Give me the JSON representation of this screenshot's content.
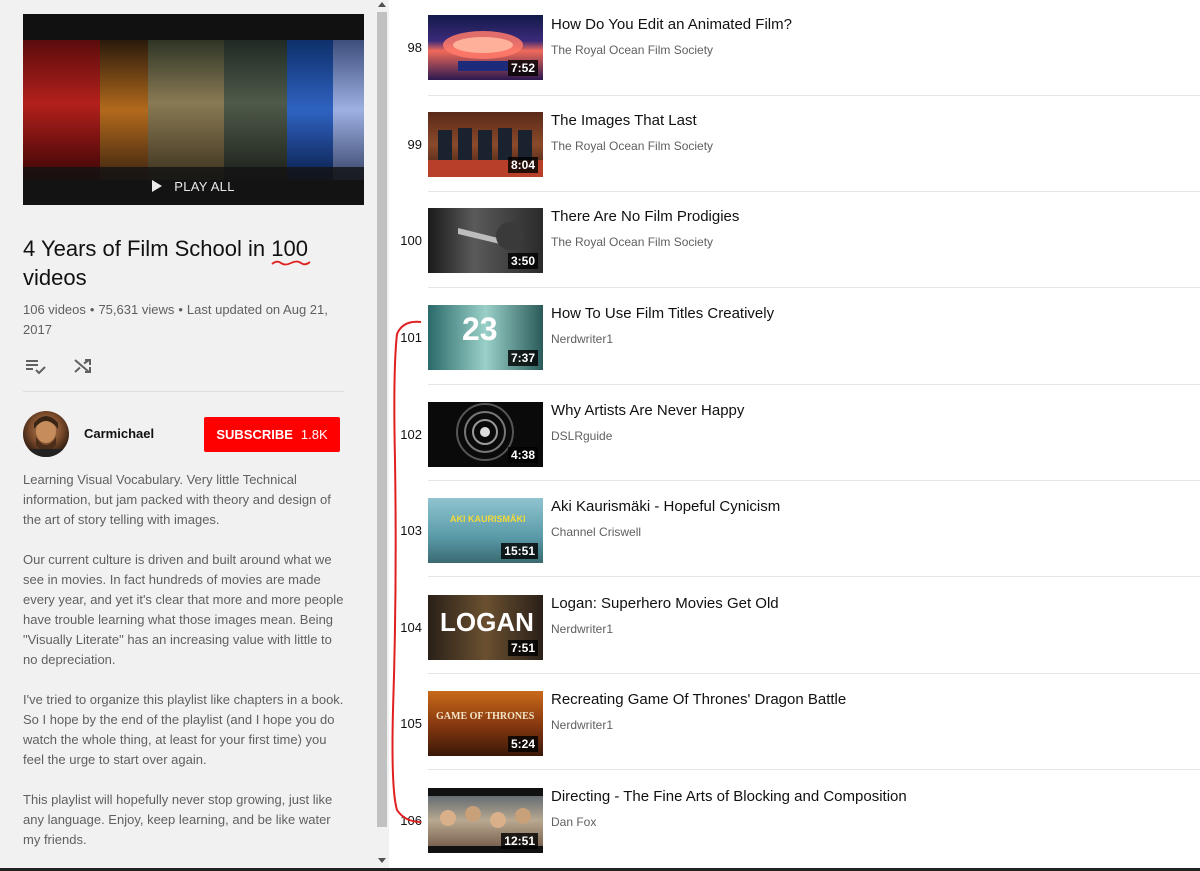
{
  "playlist": {
    "play_all_label": "PLAY ALL",
    "title_before": "4 Years of Film School in ",
    "title_highlight": "100",
    "title_after": " videos",
    "video_count": "106 videos",
    "views": "75,631 views",
    "updated": "Last updated on Aug 21, 2017",
    "annotation_color": "#e0201f",
    "actions": [
      {
        "icon": "save-to-playlist-icon"
      },
      {
        "icon": "shuffle-icon"
      }
    ]
  },
  "owner": {
    "name": "Carmichael",
    "subscribe_label": "SUBSCRIBE",
    "subscriber_count": "1.8K",
    "subscribe_color": "#ff0000"
  },
  "description": [
    "Learning Visual Vocabulary.   Very little Technical information, but jam packed with theory and design of the art of story telling with images.",
    "Our current culture is driven and built around what we see in movies.  In fact hundreds of movies are made every year, and yet it's clear that more and more people have trouble learning what those images mean.  Being \"Visually Literate\" has an increasing value with little to no depreciation.",
    "I've tried to organize this playlist like chapters in a book.  So I hope by the end of the playlist (and I hope you do watch the whole thing, at least for your first time) you feel the urge to start over again.",
    "This playlist will hopefully never stop growing, just like any language.  Enjoy, keep learning, and be like water my friends."
  ],
  "videos": [
    {
      "index": "98",
      "title": "How Do You Edit an Animated Film?",
      "channel": "The Royal Ocean Film Society",
      "duration": "7:52"
    },
    {
      "index": "99",
      "title": "The Images That Last",
      "channel": "The Royal Ocean Film Society",
      "duration": "8:04"
    },
    {
      "index": "100",
      "title": "There Are No Film Prodigies",
      "channel": "The Royal Ocean Film Society",
      "duration": "3:50"
    },
    {
      "index": "101",
      "title": "How To Use Film Titles Creatively",
      "channel": "Nerdwriter1",
      "duration": "7:37",
      "thumb_text": "23"
    },
    {
      "index": "102",
      "title": "Why Artists Are Never Happy",
      "channel": "DSLRguide",
      "duration": "4:38"
    },
    {
      "index": "103",
      "title": "Aki Kaurismäki - Hopeful Cynicism",
      "channel": "Channel Criswell",
      "duration": "15:51",
      "thumb_text": "AKI KAURISMÄKI"
    },
    {
      "index": "104",
      "title": "Logan: Superhero Movies Get Old",
      "channel": "Nerdwriter1",
      "duration": "7:51",
      "thumb_text": "LOGAN"
    },
    {
      "index": "105",
      "title": "Recreating Game Of Thrones' Dragon Battle",
      "channel": "Nerdwriter1",
      "duration": "5:24",
      "thumb_text": "GAME OF THRONES"
    },
    {
      "index": "106",
      "title": "Directing - The Fine Arts of Blocking and Composition",
      "channel": "Dan Fox",
      "duration": "12:51"
    }
  ]
}
